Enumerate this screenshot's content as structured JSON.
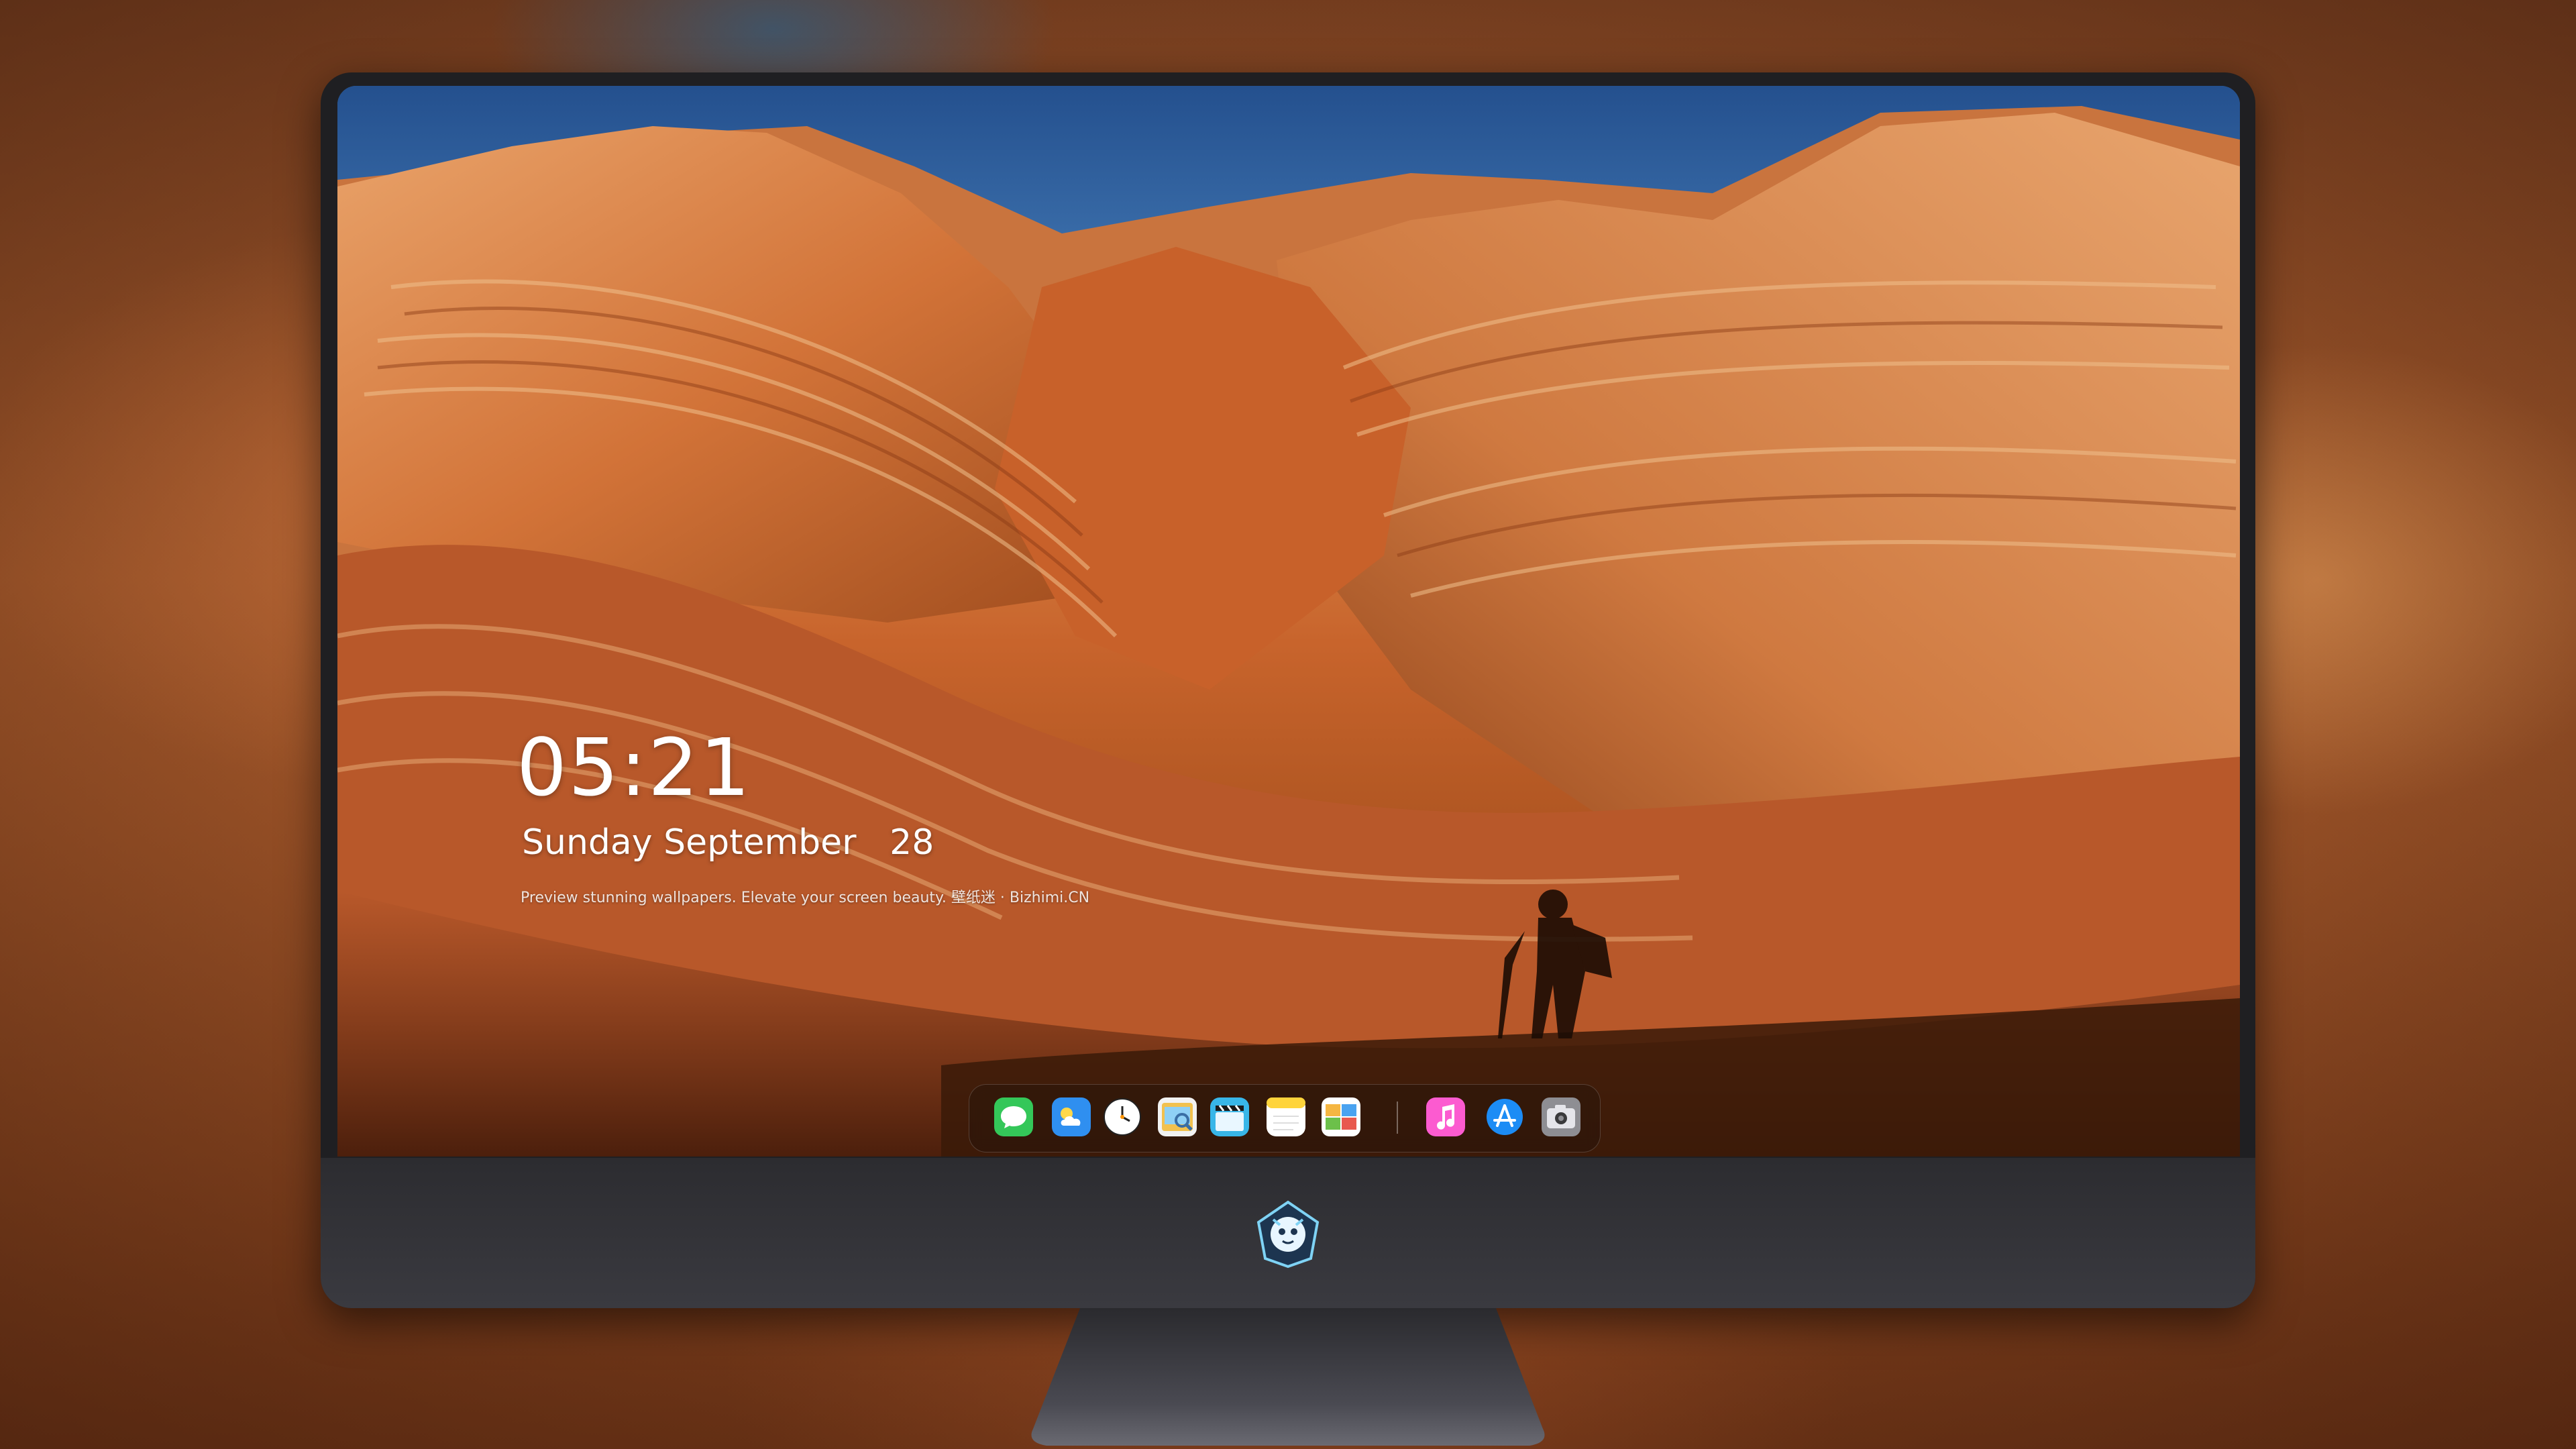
{
  "lockscreen": {
    "time": "05:21",
    "date": "Sunday September   28",
    "caption": "Preview stunning wallpapers. Elevate your screen beauty. 壁纸迷 · Bizhimi.CN"
  },
  "dock": {
    "items": [
      {
        "name": "Messages",
        "icon": "messages-icon",
        "color": "#34c759"
      },
      {
        "name": "Weather",
        "icon": "weather-icon",
        "color": "#2f8ff0"
      },
      {
        "name": "Clock",
        "icon": "clock-icon",
        "color": "#ffffff"
      },
      {
        "name": "Preview",
        "icon": "preview-icon",
        "color": "#f2c14e"
      },
      {
        "name": "Video Editor",
        "icon": "clapperboard-icon",
        "color": "#38b6e8"
      },
      {
        "name": "Notes",
        "icon": "notes-icon",
        "color": "#ffd43b"
      },
      {
        "name": "Photos",
        "icon": "photos-icon",
        "color": "#6cc04a"
      },
      {
        "name": "Music",
        "icon": "music-icon",
        "color": "#fc5bd0"
      },
      {
        "name": "App Store",
        "icon": "app-store-icon",
        "color": "#1c8cf5"
      },
      {
        "name": "Camera",
        "icon": "camera-icon",
        "color": "#8e8e93"
      }
    ]
  },
  "colors": {
    "sky": "#3d74b0",
    "rock": "#d98a4b",
    "monitor": "#2c2c30"
  }
}
